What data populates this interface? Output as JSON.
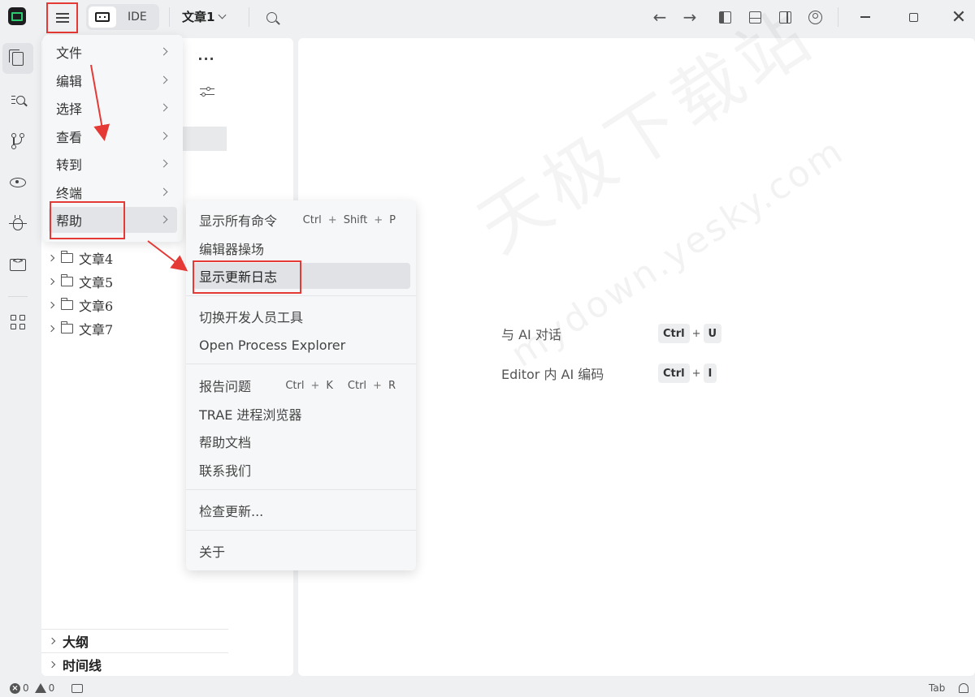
{
  "titlebar": {
    "mode_label": "IDE",
    "document_title": "文章1"
  },
  "main_menu": {
    "items": [
      {
        "label": "文件"
      },
      {
        "label": "编辑"
      },
      {
        "label": "选择"
      },
      {
        "label": "查看"
      },
      {
        "label": "转到"
      },
      {
        "label": "终端"
      },
      {
        "label": "帮助"
      }
    ],
    "active_item": "帮助"
  },
  "help_submenu": {
    "items": [
      {
        "label": "显示所有命令",
        "shortcut": [
          "Ctrl",
          "+",
          "Shift",
          "+",
          "P"
        ]
      },
      {
        "label": "编辑器操场"
      },
      {
        "label": "显示更新日志"
      },
      {
        "label": "切换开发人员工具"
      },
      {
        "label": "Open Process Explorer"
      },
      {
        "label": "报告问题",
        "shortcut": [
          "Ctrl",
          "+",
          "K",
          "Ctrl",
          "+",
          "R"
        ]
      },
      {
        "label": "TRAE 进程浏览器"
      },
      {
        "label": "帮助文档"
      },
      {
        "label": "联系我们"
      },
      {
        "label": "检查更新..."
      },
      {
        "label": "关于"
      }
    ],
    "highlighted_item": "显示更新日志"
  },
  "sidebar": {
    "more_label": "···",
    "tree": [
      "文章4",
      "文章5",
      "文章6",
      "文章7"
    ],
    "sections": [
      "大纲",
      "时间线"
    ]
  },
  "editor": {
    "hints": [
      {
        "label": "与 AI 对话",
        "keys": [
          "Ctrl",
          "+",
          "U"
        ]
      },
      {
        "label": "Editor 内 AI 编码",
        "keys": [
          "Ctrl",
          "+",
          "I"
        ]
      }
    ],
    "watermark": "天极下载站",
    "watermark_url": "mydown.yesky.com"
  },
  "statusbar": {
    "errors": "0",
    "warnings": "0",
    "tab_label": "Tab"
  },
  "colors": {
    "annotation_red": "#e53935",
    "background": "#eef0f2",
    "panel": "#ffffff"
  }
}
